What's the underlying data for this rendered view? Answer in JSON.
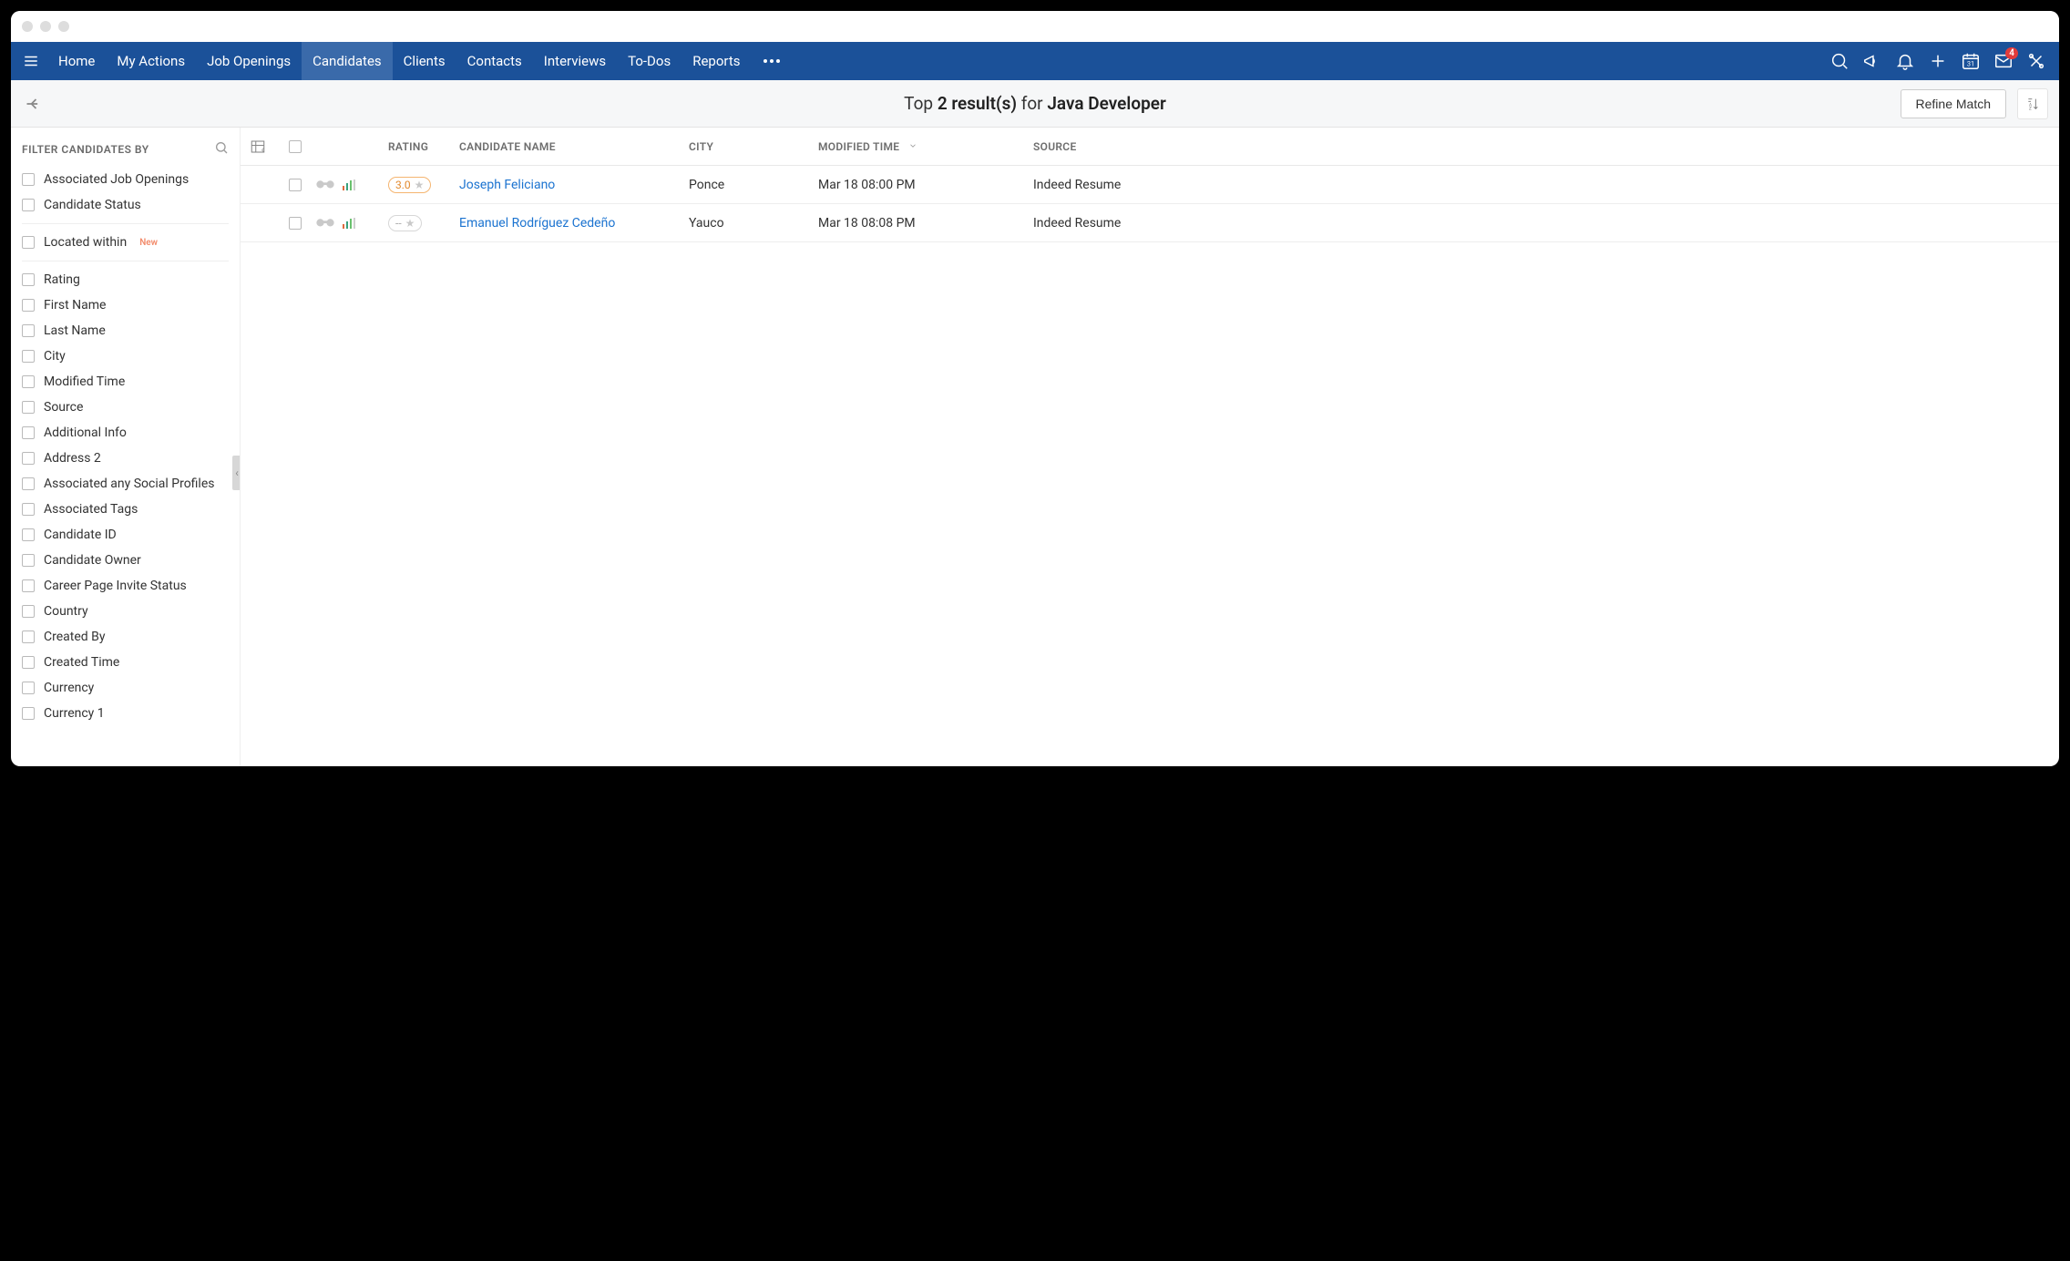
{
  "nav": {
    "items": [
      "Home",
      "My Actions",
      "Job Openings",
      "Candidates",
      "Clients",
      "Contacts",
      "Interviews",
      "To-Dos",
      "Reports"
    ],
    "active_index": 3,
    "mail_badge": "4"
  },
  "subheader": {
    "prefix": "Top",
    "count": "2 result(s)",
    "middle": "for",
    "query": "Java Developer",
    "refine_label": "Refine Match"
  },
  "filters": {
    "title": "FILTER CANDIDATES BY",
    "group1": [
      "Associated Job Openings",
      "Candidate Status"
    ],
    "located": {
      "label": "Located within",
      "badge": "New"
    },
    "group2": [
      "Rating",
      "First Name",
      "Last Name",
      "City",
      "Modified Time",
      "Source",
      "Additional Info",
      "Address 2",
      "Associated any Social Profiles",
      "Associated Tags",
      "Candidate ID",
      "Candidate Owner",
      "Career Page Invite Status",
      "Country",
      "Created By",
      "Created Time",
      "Currency",
      "Currency 1"
    ]
  },
  "table": {
    "headers": {
      "rating": "RATING",
      "name": "CANDIDATE NAME",
      "city": "CITY",
      "modified": "MODIFIED TIME",
      "source": "SOURCE"
    },
    "rows": [
      {
        "rating": "3.0",
        "name": "Joseph Feliciano",
        "city": "Ponce",
        "modified": "Mar 18 08:00 PM",
        "source": "Indeed Resume"
      },
      {
        "rating": "--",
        "name": "Emanuel Rodríguez Cedeño",
        "city": "Yauco",
        "modified": "Mar 18 08:08 PM",
        "source": "Indeed Resume"
      }
    ]
  }
}
